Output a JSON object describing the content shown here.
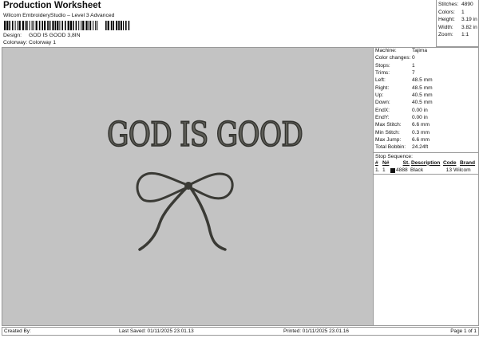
{
  "header": {
    "title": "Production Worksheet",
    "subtitle": "Wilcom EmbroideryStudio – Level 3 Advanced",
    "design_label": "Design:",
    "design_value": "GOD IS GOOD 3,8IN",
    "colorway_label": "Colorway:",
    "colorway_value": "Colorway 1"
  },
  "stats": [
    {
      "k": "Stitches:",
      "v": "4890"
    },
    {
      "k": "Colors:",
      "v": "1"
    },
    {
      "k": "Height:",
      "v": "3.19 in"
    },
    {
      "k": "Width:",
      "v": "3.82 in"
    },
    {
      "k": "Zoom:",
      "v": "1:1"
    }
  ],
  "details": [
    {
      "k": "Machine:",
      "v": "Tajima"
    },
    {
      "k": "Color changes:",
      "v": "0"
    },
    {
      "k": "Stops:",
      "v": "1"
    },
    {
      "k": "Trims:",
      "v": "7"
    },
    {
      "k": "Left:",
      "v": "48.5 mm"
    },
    {
      "k": "Right:",
      "v": "48.5 mm"
    },
    {
      "k": "Up:",
      "v": "40.5 mm"
    },
    {
      "k": "Down:",
      "v": "40.5 mm"
    },
    {
      "k": "EndX:",
      "v": "0.00 in"
    },
    {
      "k": "EndY:",
      "v": "0.00 in"
    },
    {
      "k": "Max Stitch:",
      "v": "6.6 mm"
    },
    {
      "k": "Min Stitch:",
      "v": "0.3 mm"
    },
    {
      "k": "Max Jump:",
      "v": "6.6 mm"
    },
    {
      "k": "Total Bobbin:",
      "v": "24.24ft"
    }
  ],
  "stop_sequence": {
    "title": "Stop Sequence:",
    "columns": [
      "#",
      "N#",
      "St.",
      "Description",
      "Code",
      "Brand"
    ],
    "rows": [
      {
        "num": "1.",
        "n": "1",
        "st": "4888",
        "desc": "Black",
        "code": "13",
        "brand": "Wilcom",
        "color": "#111111"
      }
    ]
  },
  "design": {
    "text": "GOD IS GOOD",
    "thread_color": "#3a3a35"
  },
  "footer": {
    "created": "Created By:",
    "saved": "Last Saved: 01/11/2025 23.01.13",
    "printed": "Printed: 01/11/2025 23.01.16",
    "page": "Page 1 of 1"
  }
}
